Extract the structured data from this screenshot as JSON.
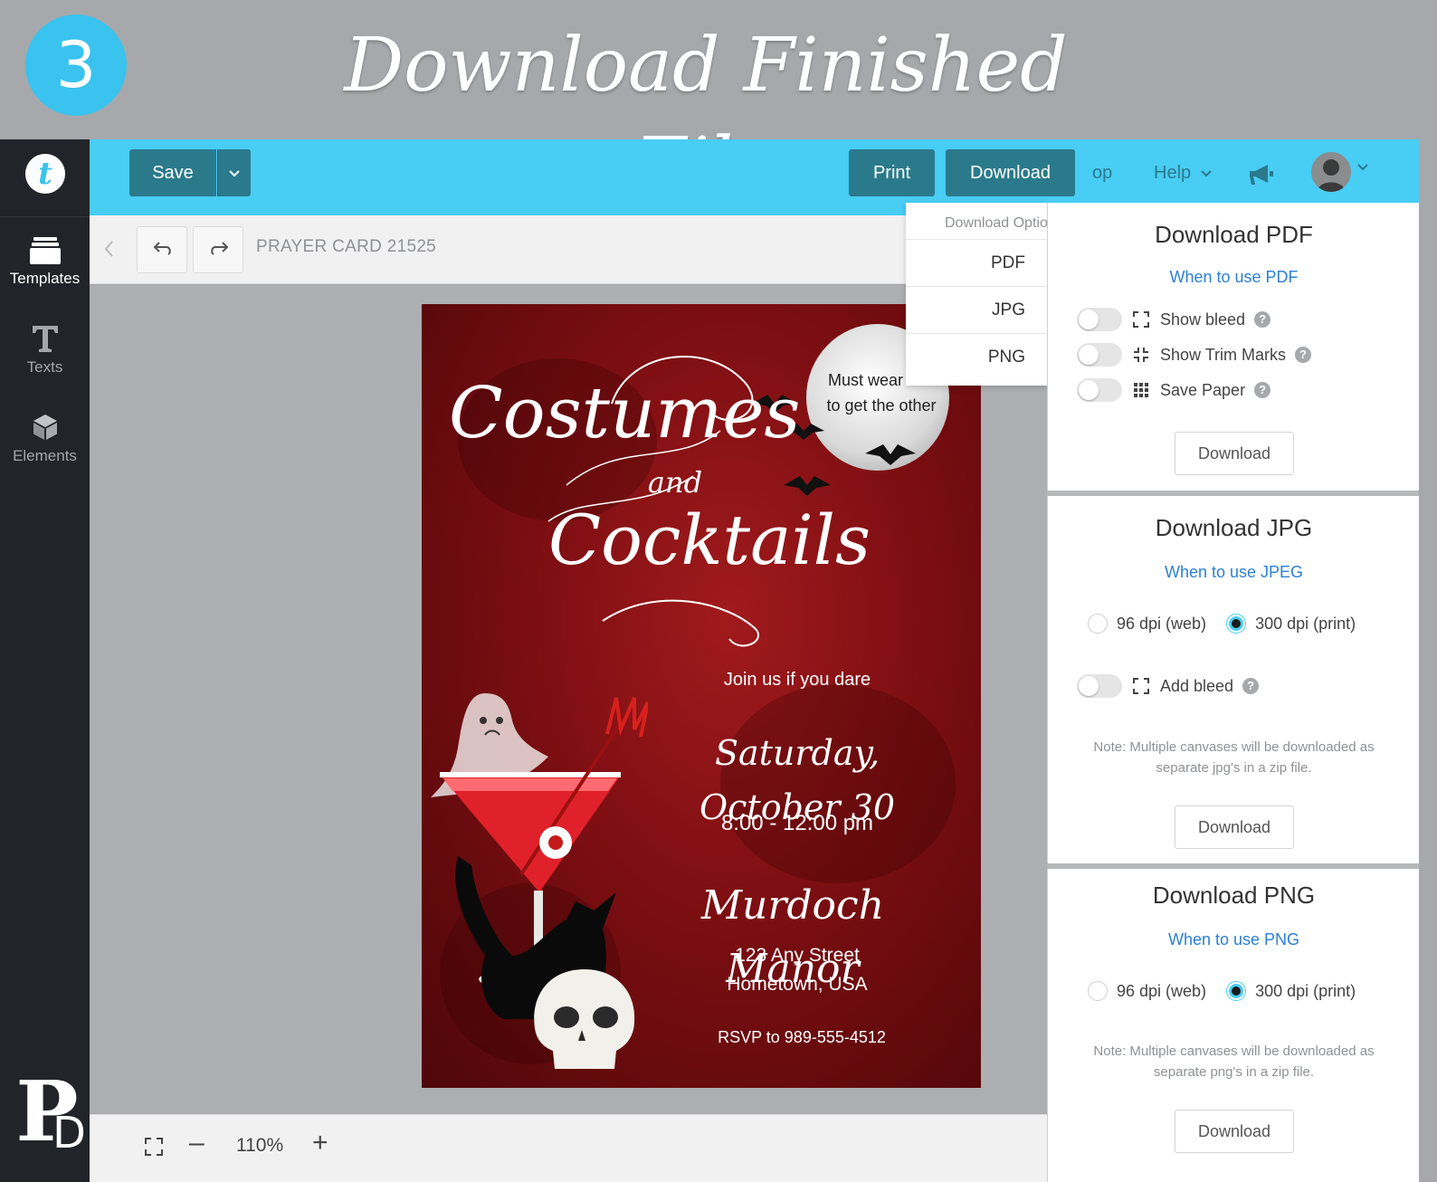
{
  "banner": {
    "step": "3",
    "title": "Download Finished File"
  },
  "sidebar": {
    "logo_letter": "t",
    "items": [
      {
        "label": "Templates",
        "icon": "templates-icon"
      },
      {
        "label": "Texts",
        "icon": "text-icon"
      },
      {
        "label": "Elements",
        "icon": "elements-icon"
      }
    ],
    "brand_mark": {
      "p": "P",
      "d": "D"
    }
  },
  "toolbar": {
    "save_label": "Save",
    "print_label": "Print",
    "download_label": "Download",
    "op_label": "op",
    "help_label": "Help"
  },
  "subbar": {
    "document_title": "PRAYER CARD 21525"
  },
  "zoom": {
    "value": "110%",
    "minus": "–",
    "plus": "+"
  },
  "card": {
    "title_1": "Costumes",
    "title_and": "and",
    "title_2": "Cocktails",
    "moon_line_1": "Must wear one",
    "moon_line_2": "to get the other",
    "invite": "Join us if you dare",
    "date": "Saturday, October 30",
    "time": "8:00 - 12:00 pm",
    "venue": "Murdoch Manor",
    "address_1": "123 Any Street",
    "address_2": "Hometown, USA",
    "rsvp": "RSVP to 989-555-4512"
  },
  "download_options": {
    "header": "Download Options",
    "items": [
      "PDF",
      "JPG",
      "PNG"
    ]
  },
  "pdf_panel": {
    "title": "Download PDF",
    "link": "When to use PDF",
    "options": [
      {
        "label": "Show bleed",
        "icon": "bleed-icon"
      },
      {
        "label": "Show Trim Marks",
        "icon": "trim-marks-icon"
      },
      {
        "label": "Save Paper",
        "icon": "grid-icon"
      }
    ],
    "button": "Download"
  },
  "jpg_panel": {
    "title": "Download JPG",
    "link": "When to use JPEG",
    "dpi_web": "96 dpi (web)",
    "dpi_print": "300 dpi (print)",
    "selected": "300 dpi (print)",
    "bleed_label": "Add bleed",
    "note": "Note: Multiple canvases will be downloaded as separate jpg's in a zip file.",
    "button": "Download"
  },
  "png_panel": {
    "title": "Download PNG",
    "link": "When to use PNG",
    "dpi_web": "96 dpi (web)",
    "dpi_print": "300 dpi (print)",
    "selected": "300 dpi (print)",
    "note": "Note: Multiple canvases will be downloaded as separate png's in a zip file.",
    "button": "Download"
  },
  "colors": {
    "accent": "#48cdf4",
    "button_dark": "#2a7a8c",
    "sidebar": "#212428",
    "link": "#2c7fd6",
    "card_red": "#8b1014"
  }
}
